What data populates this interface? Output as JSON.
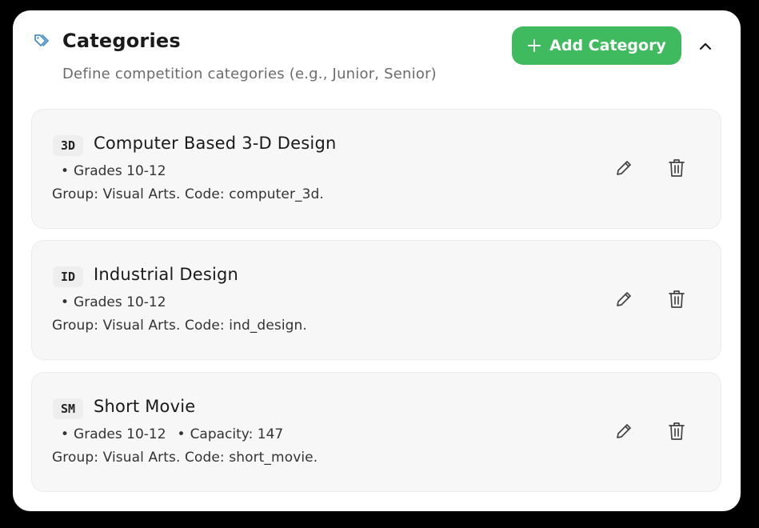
{
  "header": {
    "title": "Categories",
    "subtitle": "Define competition categories (e.g., Junior, Senior)",
    "icon": "tag-icon",
    "add_button_label": "Add Category",
    "collapse_icon": "chevron-up-icon"
  },
  "colors": {
    "accent_green": "#3fba5e",
    "tag_icon_blue": "#4a90c8",
    "card_bg": "#f7f7f7"
  },
  "categories": [
    {
      "badge": "3D",
      "name": "Computer Based 3-D Design",
      "grades": "Grades 10-12",
      "capacity": "",
      "group_line": "Group: Visual Arts. Code: computer_3d."
    },
    {
      "badge": "ID",
      "name": "Industrial Design",
      "grades": "Grades 10-12",
      "capacity": "",
      "group_line": "Group: Visual Arts. Code: ind_design."
    },
    {
      "badge": "SM",
      "name": "Short Movie",
      "grades": "Grades 10-12",
      "capacity": "Capacity: 147",
      "group_line": "Group: Visual Arts. Code: short_movie."
    }
  ]
}
